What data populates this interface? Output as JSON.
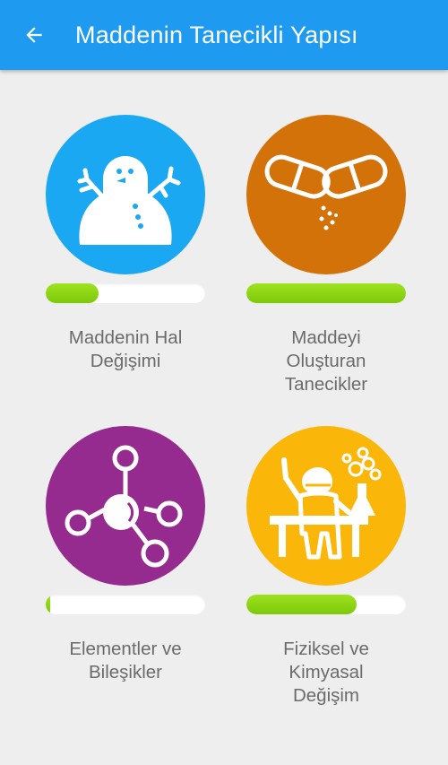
{
  "header": {
    "title": "Maddenin Tanecikli Yapısı",
    "background_color": "#1e9bf0",
    "back_icon": "arrow-left-icon"
  },
  "topics": [
    {
      "label": "Maddenin Hal\nDeğişimi",
      "color": "#1ba8f2",
      "icon": "snowman-icon",
      "progress_percent": 33
    },
    {
      "label": "Maddeyi\nOluşturan\nTanecikler",
      "color": "#d4720a",
      "icon": "capsule-icon",
      "progress_percent": 100
    },
    {
      "label": "Elementler ve\nBileşikler",
      "color": "#952a8f",
      "icon": "molecule-icon",
      "progress_percent": 3
    },
    {
      "label": "Fiziksel ve\nKimyasal\nDeğişim",
      "color": "#fbb60a",
      "icon": "scientist-icon",
      "progress_percent": 69
    }
  ],
  "progress_color": "#8ad414"
}
